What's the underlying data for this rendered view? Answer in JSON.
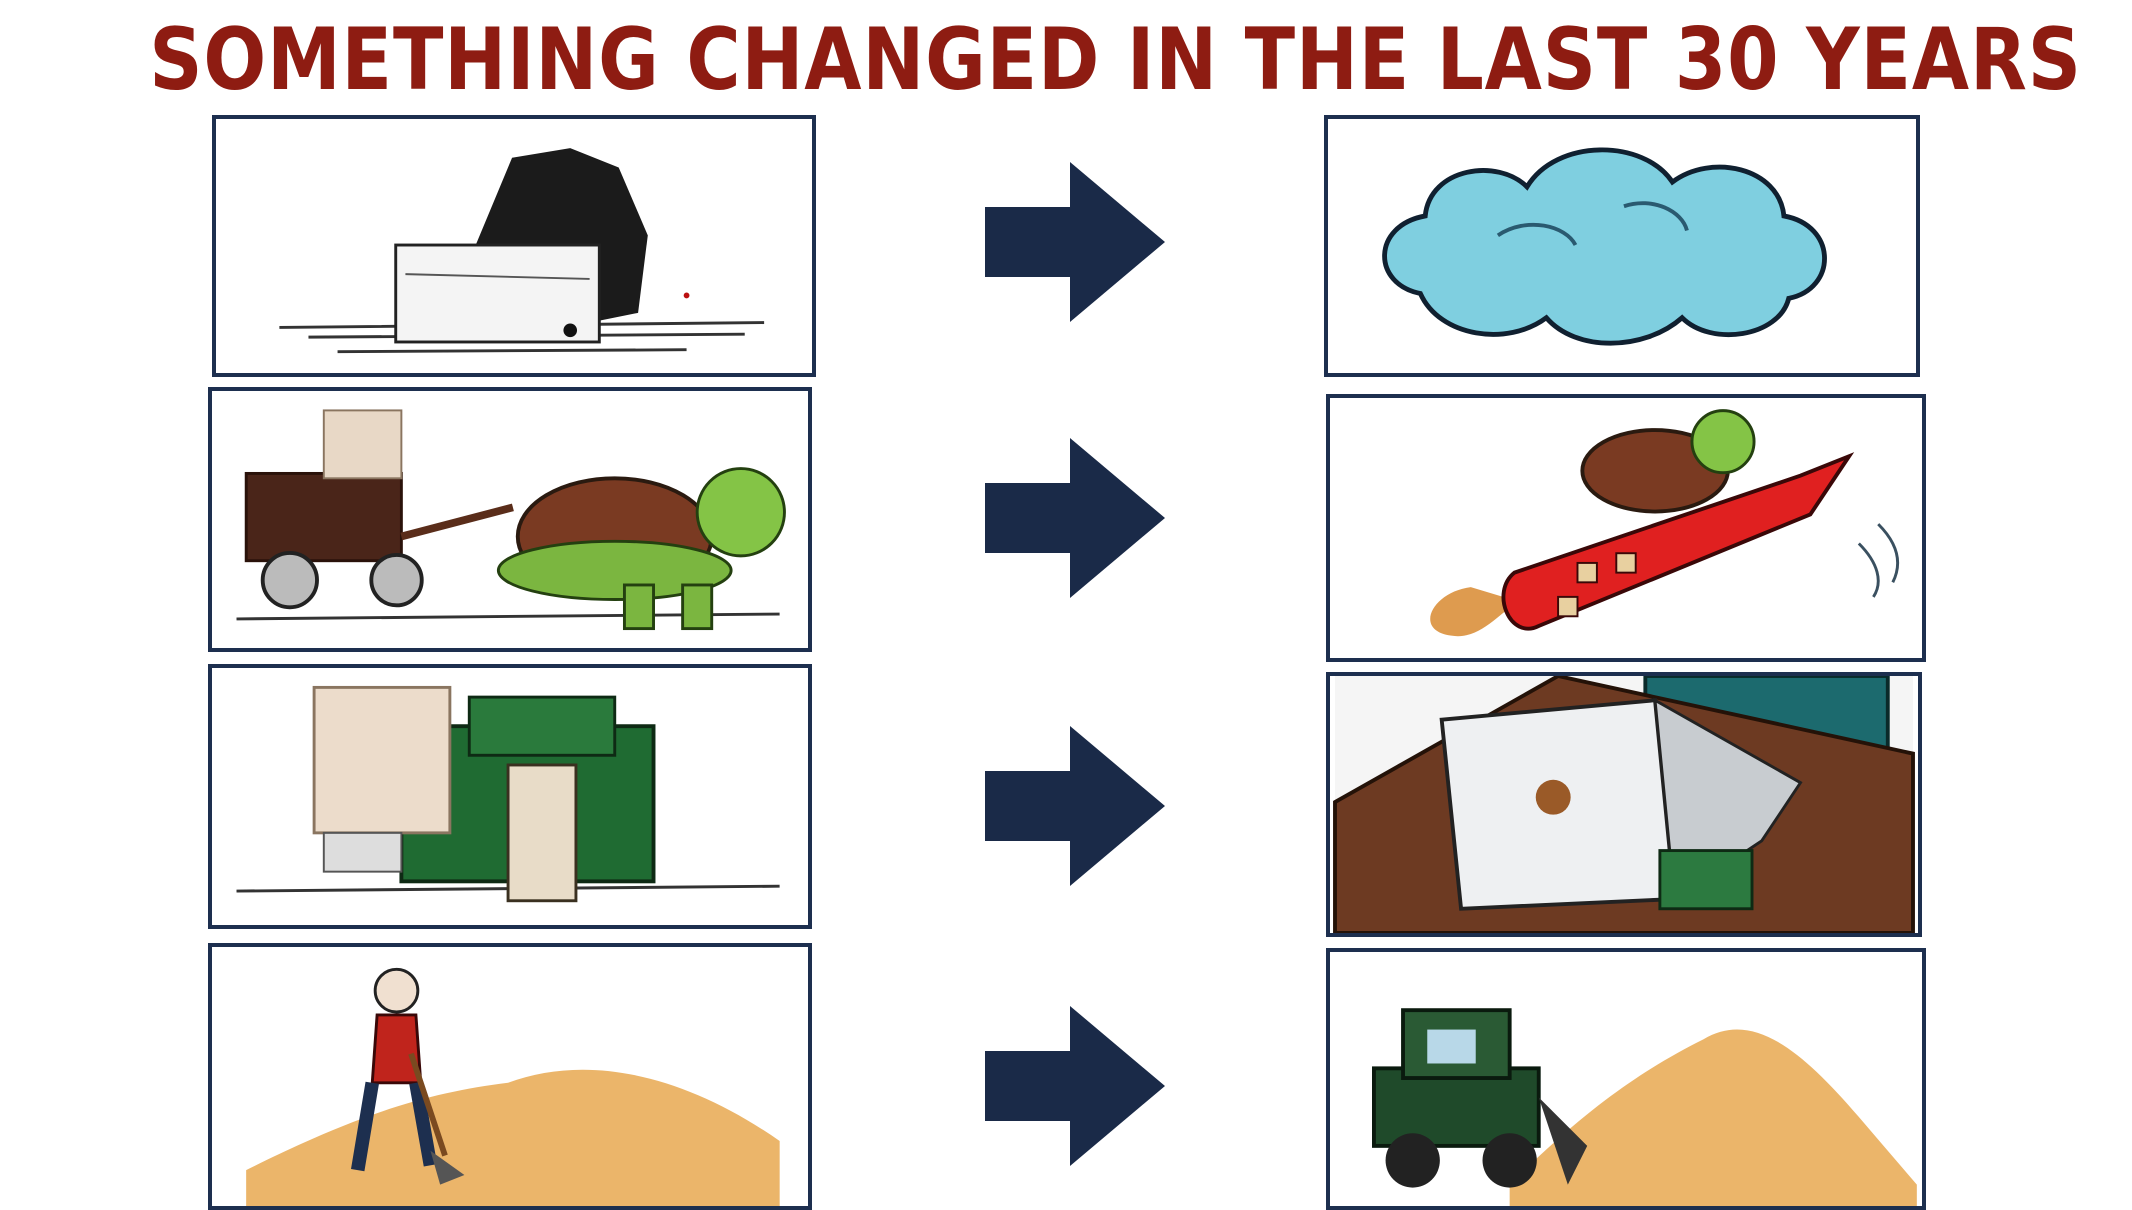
{
  "title": "SOMETHING CHANGED IN THE LAST 30 YEARS",
  "colors": {
    "title": "#8e1c12",
    "frame": "#1d2f4f",
    "arrow": "#1a2a48"
  },
  "rows": [
    {
      "before": "mainframe-computer-cards-icon",
      "after": "cloud-icon"
    },
    {
      "before": "tortoise-pulling-cart-icon",
      "after": "tortoise-riding-rocket-icon"
    },
    {
      "before": "computer-and-money-stacks-icon",
      "after": "laptop-on-desk-icon"
    },
    {
      "before": "person-digging-with-shovel-icon",
      "after": "bulldozer-moving-sand-icon"
    }
  ]
}
